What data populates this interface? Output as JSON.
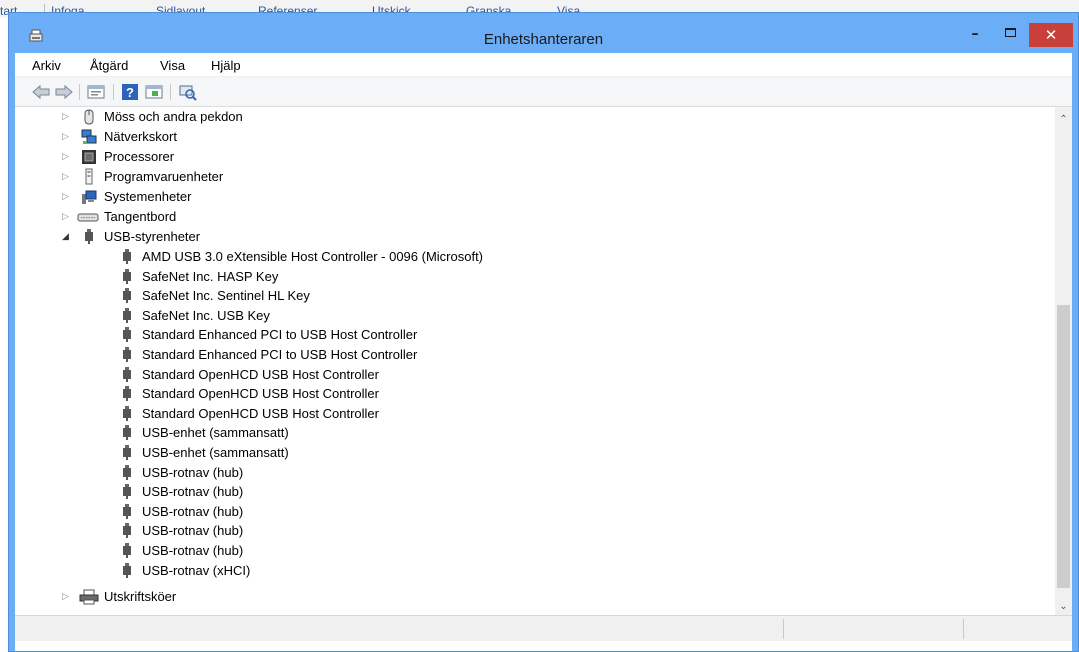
{
  "background_app": {
    "ribbon_tabs": [
      "tart",
      "Infoga",
      "Sidlayout",
      "Referenser",
      "Utskick",
      "Granska",
      "Visa"
    ]
  },
  "window": {
    "title": "Enhetshanteraren",
    "minimize_glyph": "–",
    "close_glyph": "✕"
  },
  "menu": {
    "items": [
      "Arkiv",
      "Åtgärd",
      "Visa",
      "Hjälp"
    ]
  },
  "toolbar": {
    "buttons": [
      "back-arrow-icon",
      "forward-arrow-icon",
      "properties-icon",
      "help-icon",
      "view-icon",
      "scan-hardware-icon"
    ]
  },
  "tree": {
    "categories_before": [
      {
        "label": "Möss och andra pekdon",
        "icon": "mouse-icon"
      },
      {
        "label": "Nätverkskort",
        "icon": "network-adapter-icon"
      },
      {
        "label": "Processorer",
        "icon": "processor-icon"
      },
      {
        "label": "Programvaruenheter",
        "icon": "software-device-icon"
      },
      {
        "label": "Systemenheter",
        "icon": "system-device-icon"
      },
      {
        "label": "Tangentbord",
        "icon": "keyboard-icon"
      }
    ],
    "expanded_category": {
      "label": "USB-styrenheter",
      "icon": "usb-controller-icon",
      "children": [
        "AMD USB 3.0 eXtensible Host Controller - 0096 (Microsoft)",
        "SafeNet Inc. HASP Key",
        "SafeNet Inc. Sentinel HL Key",
        "SafeNet Inc. USB Key",
        "Standard Enhanced PCI to USB Host Controller",
        "Standard Enhanced PCI to USB Host Controller",
        "Standard OpenHCD USB Host Controller",
        "Standard OpenHCD USB Host Controller",
        "Standard OpenHCD USB Host Controller",
        "USB-enhet (sammansatt)",
        "USB-enhet (sammansatt)",
        "USB-rotnav (hub)",
        "USB-rotnav (hub)",
        "USB-rotnav (hub)",
        "USB-rotnav (hub)",
        "USB-rotnav (hub)",
        "USB-rotnav (xHCI)"
      ]
    },
    "categories_after": [
      {
        "label": "Utskriftsköer",
        "icon": "printer-icon"
      }
    ]
  },
  "colors": {
    "title_bar": "#6badf6",
    "close_button": "#c7403a",
    "ribbon_text": "#2b579a"
  }
}
